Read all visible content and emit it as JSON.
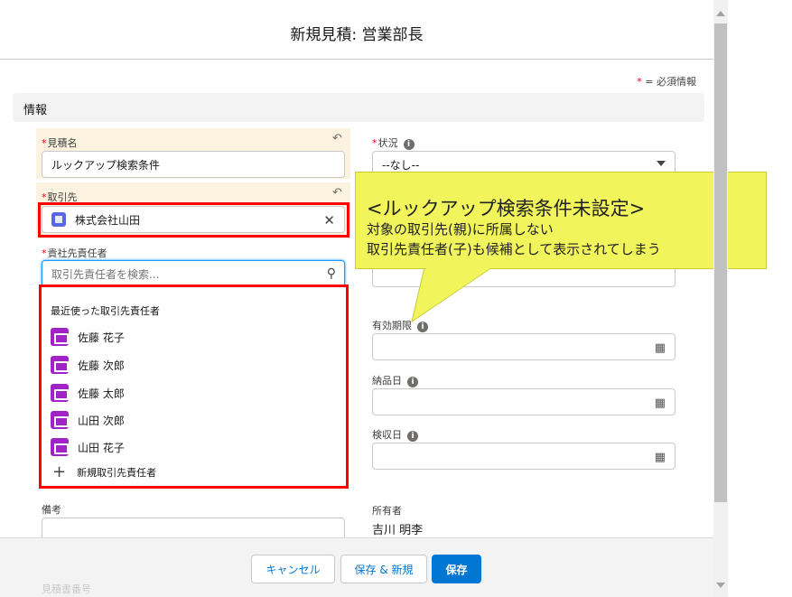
{
  "modal": {
    "title": "新規見積: 営業部長"
  },
  "required_legend": {
    "star": "*",
    "text": " = 必須情報"
  },
  "section": {
    "title": "情報"
  },
  "fields": {
    "quote_name": {
      "label": "見積名",
      "value": "ルックアップ検索条件"
    },
    "status": {
      "label": "状況",
      "value": "--なし--"
    },
    "account": {
      "label": "取引先",
      "value": "株式会社山田"
    },
    "contact": {
      "label": "貴社先責任者",
      "placeholder": "取引先責任者を検索..."
    },
    "valid_until": {
      "label": "有効期限"
    },
    "delivery_date": {
      "label": "納品日"
    },
    "inspection_date": {
      "label": "検収日"
    },
    "remarks": {
      "label": "備考"
    },
    "owner": {
      "label": "所有者",
      "value": "吉川 明李"
    },
    "quote_number": {
      "label": "見積書番号"
    }
  },
  "dropdown": {
    "header": "最近使った取引先責任者",
    "items": [
      {
        "label": "佐藤 花子"
      },
      {
        "label": "佐藤 次郎"
      },
      {
        "label": "佐藤 太郎"
      },
      {
        "label": "山田 次郎"
      },
      {
        "label": "山田 花子"
      }
    ],
    "new_item": "新規取引先責任者"
  },
  "callout": {
    "title": "<ルックアップ検索条件未設定>",
    "line1": "対象の取引先(親)に所属しない",
    "line2": "取引先責任者(子)も候補として表示されてしまう"
  },
  "footer": {
    "cancel": "キャンセル",
    "save_new": "保存 & 新規",
    "save": "保存"
  },
  "icons": {
    "undo": "undo-icon",
    "info": "info-icon",
    "search": "search-icon",
    "clear": "clear-icon",
    "calendar": "calendar-icon",
    "account": "account-icon",
    "contact": "contact-icon",
    "add": "add-icon"
  },
  "colors": {
    "required": "#ea001e",
    "highlight_box": "#ff0000",
    "callout_bg": "#f1f45a",
    "brand": "#0176d3",
    "contact_icon": "#a024c5",
    "account_icon": "#5867e8",
    "required_field_bg": "#fcf2e0"
  }
}
